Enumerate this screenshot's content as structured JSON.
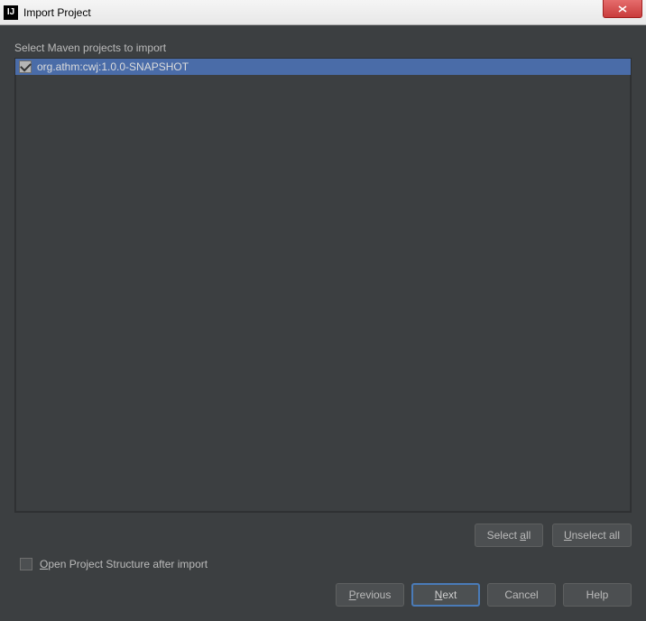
{
  "titlebar": {
    "title": "Import Project",
    "app_icon_label": "IJ"
  },
  "content": {
    "list_label": "Select Maven projects to import",
    "projects": [
      {
        "label": "org.athm:cwj:1.0.0-SNAPSHOT",
        "checked": true,
        "selected": true
      }
    ]
  },
  "selection_buttons": {
    "select_all_pre": "Select ",
    "select_all_m": "a",
    "select_all_post": "ll",
    "unselect_all_m": "U",
    "unselect_all_post": "nselect all"
  },
  "options": {
    "open_structure_m": "O",
    "open_structure_post": "pen Project Structure after import",
    "open_structure_checked": false
  },
  "buttons": {
    "previous_m": "P",
    "previous_post": "revious",
    "next_m": "N",
    "next_post": "ext",
    "cancel": "Cancel",
    "help": "Help"
  }
}
